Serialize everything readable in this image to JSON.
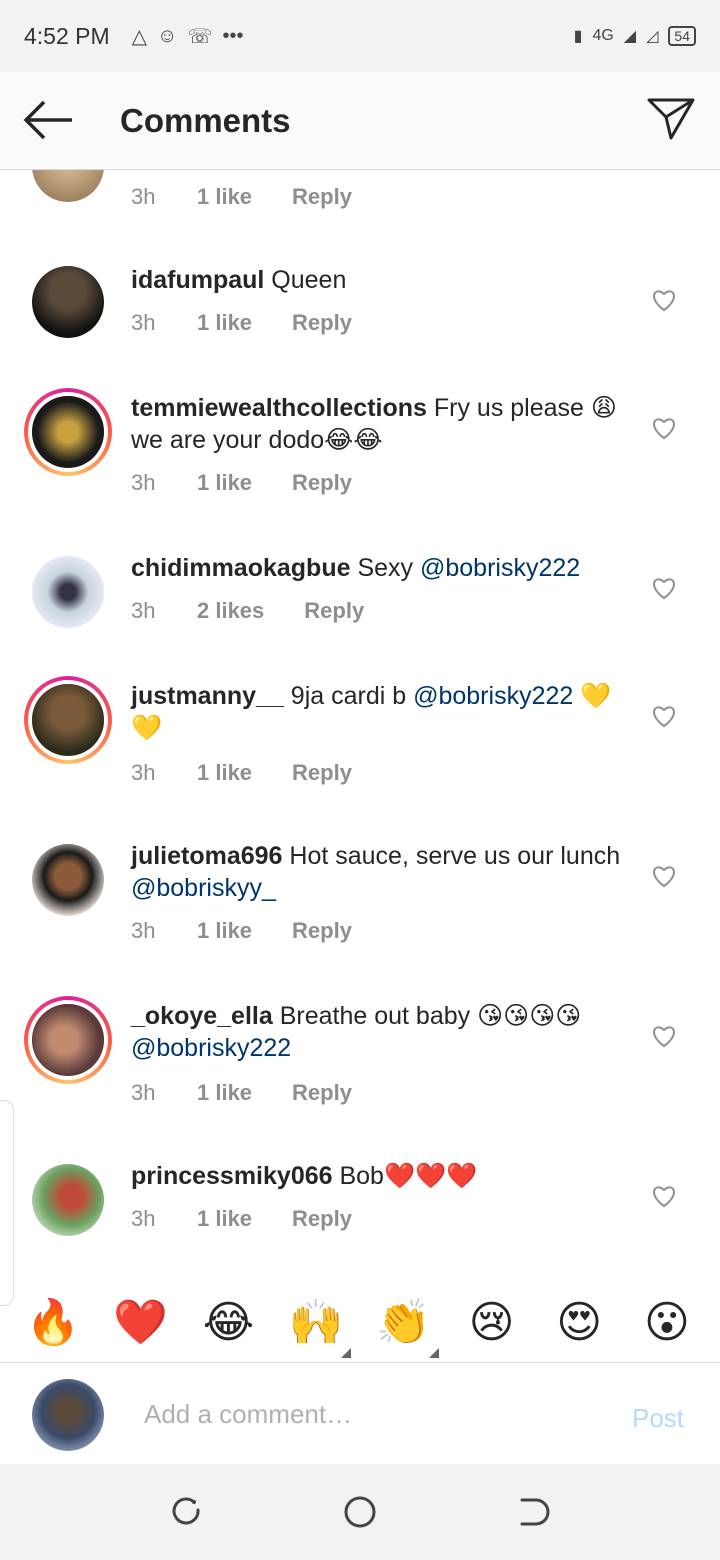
{
  "status_bar": {
    "time": "4:52 PM",
    "network": "4G",
    "battery": "54",
    "left_icons": [
      "alert-triangle-icon",
      "face-icon",
      "missed-call-icon",
      "more-dots-icon"
    ]
  },
  "header": {
    "title": "Comments",
    "back_icon": "arrow-left-icon",
    "send_icon": "send-icon"
  },
  "comments": [
    {
      "username": "",
      "text": "",
      "time": "3h",
      "likes": "1 like",
      "reply": "Reply",
      "ring": false,
      "avatar_color": "#8a6a4a"
    },
    {
      "username": "idafumpaul",
      "text": " Queen",
      "mention": "",
      "extra": "",
      "time": "3h",
      "likes": "1 like",
      "reply": "Reply",
      "ring": false,
      "avatar_color": "#2b2b2b"
    },
    {
      "username": "temmiewealthcollections",
      "text": " Fry us please 😩 we are your dodo😂😂",
      "mention": "",
      "extra": "",
      "time": "3h",
      "likes": "1 like",
      "reply": "Reply",
      "ring": true,
      "avatar_color": "#1a1a1a"
    },
    {
      "username": "chidimmaokagbue",
      "text": " Sexy ",
      "mention": "@bobrisky222",
      "extra": "",
      "time": "3h",
      "likes": "2 likes",
      "reply": "Reply",
      "ring": false,
      "avatar_color": "#c8d4dc"
    },
    {
      "username": "justmanny__",
      "text": " 9ja cardi b ",
      "mention": "@bobrisky222",
      "extra": " 💛💛",
      "time": "3h",
      "likes": "1 like",
      "reply": "Reply",
      "ring": true,
      "avatar_color": "#4a3a2a"
    },
    {
      "username": "julietoma696",
      "text": " Hot sauce, serve us our lunch ",
      "mention": "@bobriskyy_",
      "extra": "",
      "time": "3h",
      "likes": "1 like",
      "reply": "Reply",
      "ring": false,
      "avatar_color": "#e8d0c0"
    },
    {
      "username": "_okoye_ella",
      "text": " Breathe out baby 😘😘😘😘",
      "mention": "@bobrisky222",
      "extra": "",
      "time": "3h",
      "likes": "1 like",
      "reply": "Reply",
      "ring": true,
      "avatar_color": "#9a6a5a"
    },
    {
      "username": "princessmiky066",
      "text": " Bob❤️❤️❤️",
      "mention": "",
      "extra": "",
      "time": "3h",
      "likes": "1 like",
      "reply": "Reply",
      "ring": false,
      "avatar_color": "#6aa060"
    }
  ],
  "emoji_bar": [
    "🔥",
    "❤️",
    "😂",
    "🙌",
    "👏",
    "😢",
    "😍",
    "😮"
  ],
  "composer": {
    "placeholder": "Add a comment…",
    "post_label": "Post",
    "avatar_color": "#3a4a6a"
  },
  "nav": {
    "icons": [
      "recents-icon",
      "home-icon",
      "back-icon"
    ]
  },
  "colors": {
    "mention": "#003569",
    "meta": "#8e8e8e",
    "post_disabled": "#b3dbff"
  }
}
